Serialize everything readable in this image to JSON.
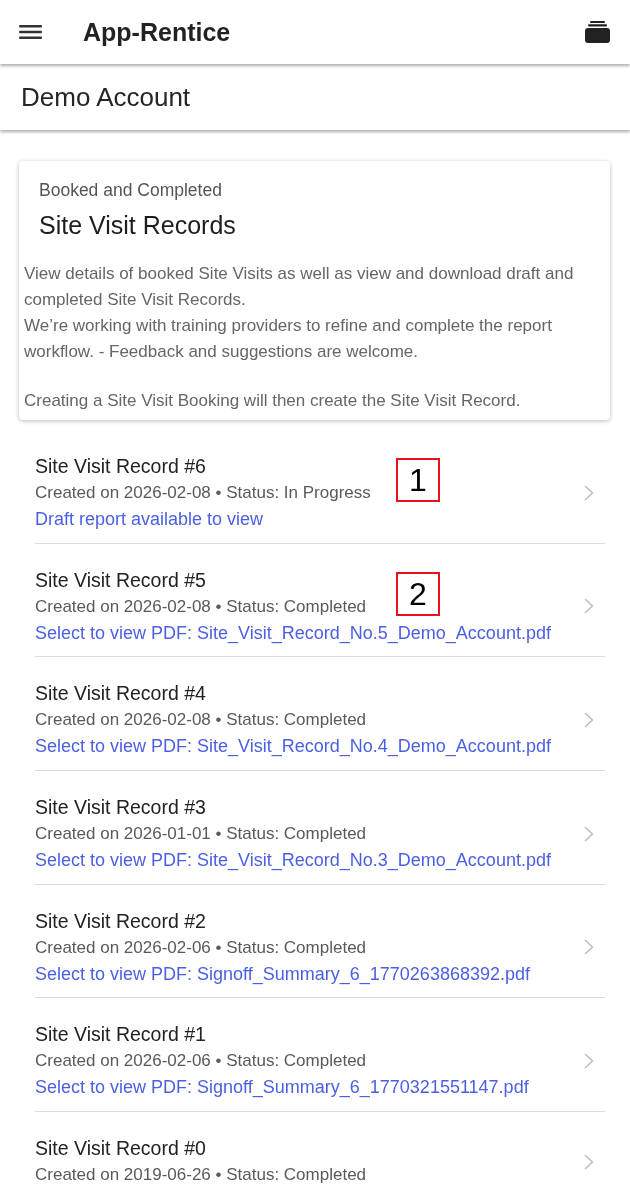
{
  "app_bar": {
    "title": "App-Rentice"
  },
  "account_bar": {
    "title": "Demo Account"
  },
  "info_card": {
    "subtitle": "Booked and Completed",
    "title": "Site Visit Records",
    "blocks": [
      [
        "View details of booked Site Visits as well as view and download draft and completed Site Visit Records.",
        "We’re working with training providers to refine and complete the report workflow. - Feedback and suggestions are welcome."
      ],
      [
        "Creating a Site Visit Booking will then create the Site Visit Record."
      ]
    ]
  },
  "records": [
    {
      "title": "Site Visit Record #6",
      "meta": "Created on 2026-02-08 • Status: In Progress",
      "link": "Draft report available to view",
      "annotation": "1"
    },
    {
      "title": "Site Visit Record #5",
      "meta": "Created on 2026-02-08 • Status: Completed",
      "link": "Select to view PDF: Site_Visit_Record_No.5_Demo_Account.pdf",
      "annotation": "2"
    },
    {
      "title": "Site Visit Record #4",
      "meta": "Created on 2026-02-08 • Status: Completed",
      "link": "Select to view PDF: Site_Visit_Record_No.4_Demo_Account.pdf"
    },
    {
      "title": "Site Visit Record #3",
      "meta": "Created on 2026-01-01 • Status: Completed",
      "link": "Select to view PDF: Site_Visit_Record_No.3_Demo_Account.pdf"
    },
    {
      "title": "Site Visit Record #2",
      "meta": "Created on 2026-02-06 • Status: Completed",
      "link": "Select to view PDF: Signoff_Summary_6_1770263868392.pdf"
    },
    {
      "title": "Site Visit Record #1",
      "meta": "Created on 2026-02-06 • Status: Completed",
      "link": "Select to view PDF: Signoff_Summary_6_1770321551147.pdf"
    },
    {
      "title": "Site Visit Record #0",
      "meta": "Created on 2019-06-26 • Status: Completed"
    }
  ]
}
